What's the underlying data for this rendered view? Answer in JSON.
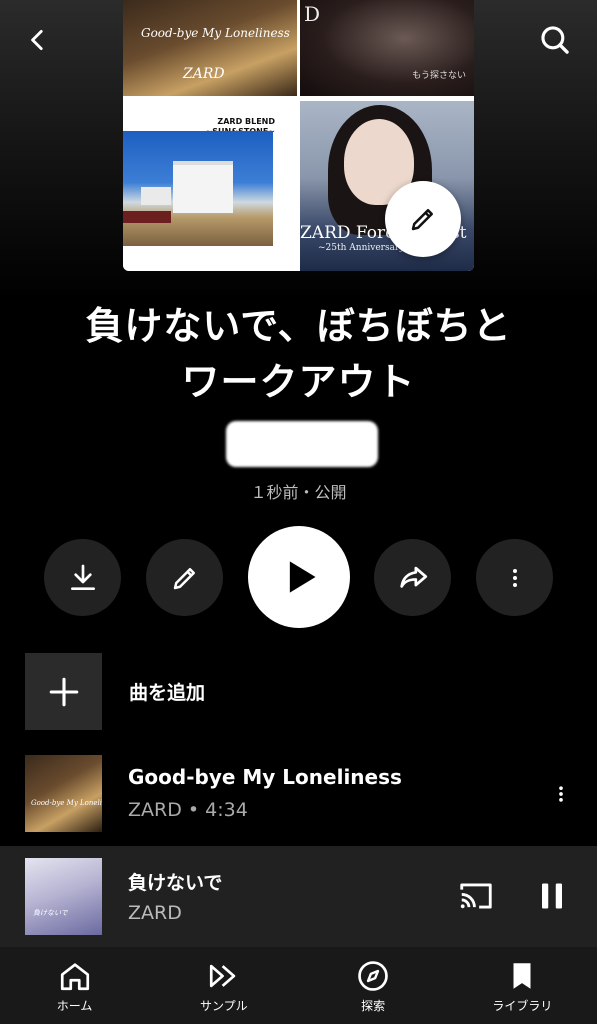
{
  "playlist": {
    "title_line1": "負けないで、ぼちぼちと",
    "title_line2": "ワークアウト",
    "meta": "１秒前・公開",
    "covers": {
      "c1_title": "Good-bye My Loneliness",
      "c1_artist": "ZARD",
      "c2_letter": "D",
      "c2_side": "もう探さない",
      "c3_title": "ZARD BLEND",
      "c3_sub": "~SUN&STONE~",
      "c4_title": "ZARD Forever Best",
      "c4_sub": "~25th Anniversary~"
    }
  },
  "add_song": {
    "label": "曲を追加"
  },
  "tracks": [
    {
      "title": "Good-bye My Loneliness",
      "subtitle": "ZARD • 4:34",
      "thumb_text": "Good-bye My Loneliness"
    }
  ],
  "now_playing": {
    "title": "負けないで",
    "artist": "ZARD",
    "thumb_text": "負けないで"
  },
  "nav": {
    "home": "ホーム",
    "samples": "サンプル",
    "explore": "探索",
    "library": "ライブラリ"
  },
  "icons": {
    "back": "chevron-left-icon",
    "search": "search-icon",
    "edit": "pencil-icon",
    "download": "download-icon",
    "play": "play-icon",
    "share": "share-icon",
    "more": "more-vertical-icon",
    "add": "plus-icon",
    "cast": "cast-icon",
    "pause": "pause-icon"
  }
}
